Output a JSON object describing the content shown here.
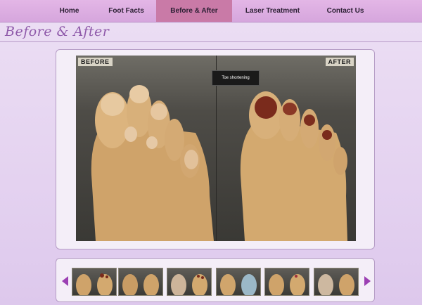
{
  "nav": {
    "items": [
      {
        "label": "Home"
      },
      {
        "label": "Foot Facts"
      },
      {
        "label": "Before & After",
        "active": true
      },
      {
        "label": "Laser Treatment"
      },
      {
        "label": "Contact Us"
      }
    ]
  },
  "page": {
    "title": "Before & After"
  },
  "viewer": {
    "before_label": "BEFORE",
    "after_label": "AFTER",
    "caption": "Toe shortening"
  },
  "thumbnails": {
    "count": 6,
    "prev_icon": "arrow-left-icon",
    "next_icon": "arrow-right-icon"
  },
  "colors": {
    "nav_bg": "#d6a6dd",
    "nav_active": "#c97aa7",
    "title": "#8f5aaa",
    "arrow": "#9b3fb3",
    "skin": "#d9b27a",
    "nail_polish": "#7a2b1c"
  }
}
